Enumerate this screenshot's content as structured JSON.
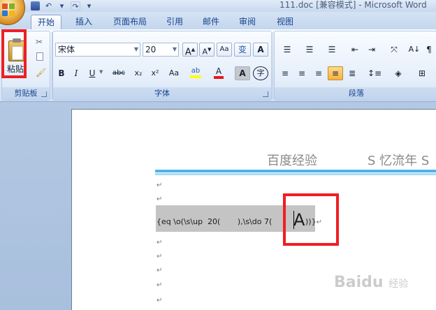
{
  "window": {
    "title": "111.doc [兼容模式] - Microsoft Word"
  },
  "qat": {
    "save_icon": "save-icon",
    "undo_icon": "undo-icon",
    "redo_icon": "redo-icon",
    "customize_icon": "customize-icon"
  },
  "tabs": [
    {
      "label": "开始",
      "active": true
    },
    {
      "label": "插入"
    },
    {
      "label": "页面布局"
    },
    {
      "label": "引用"
    },
    {
      "label": "邮件"
    },
    {
      "label": "审阅"
    },
    {
      "label": "视图"
    }
  ],
  "ribbon": {
    "clipboard": {
      "paste_label": "粘贴",
      "group_label": "剪贴板"
    },
    "font": {
      "font_name": "宋体",
      "font_size": "20",
      "grow_label": "A",
      "shrink_label": "A",
      "phonetic_label": "变",
      "border_label": "A",
      "bold": "B",
      "italic": "I",
      "underline": "U",
      "strike": "abc",
      "subscript": "x₂",
      "superscript": "x²",
      "change_case": "Aa",
      "font_color": "A",
      "char_shading": "A",
      "enclose_label": "字",
      "group_label": "字体"
    },
    "paragraph": {
      "group_label": "段落"
    }
  },
  "document": {
    "header_left": "百度经验",
    "header_right": "S 忆流年 S",
    "field_code": "{eq \\o(\\s\\up  20(       ),\\s\\do 7(       ",
    "field_char": "A",
    "field_tail": "))}",
    "para_mark": "↵"
  },
  "watermark": {
    "text": "Baidu",
    "sub": "经验"
  },
  "colors": {
    "highlight_red": "#f01e23",
    "header_rule": "#4fb4e6",
    "field_shading": "#c4c4c4"
  }
}
